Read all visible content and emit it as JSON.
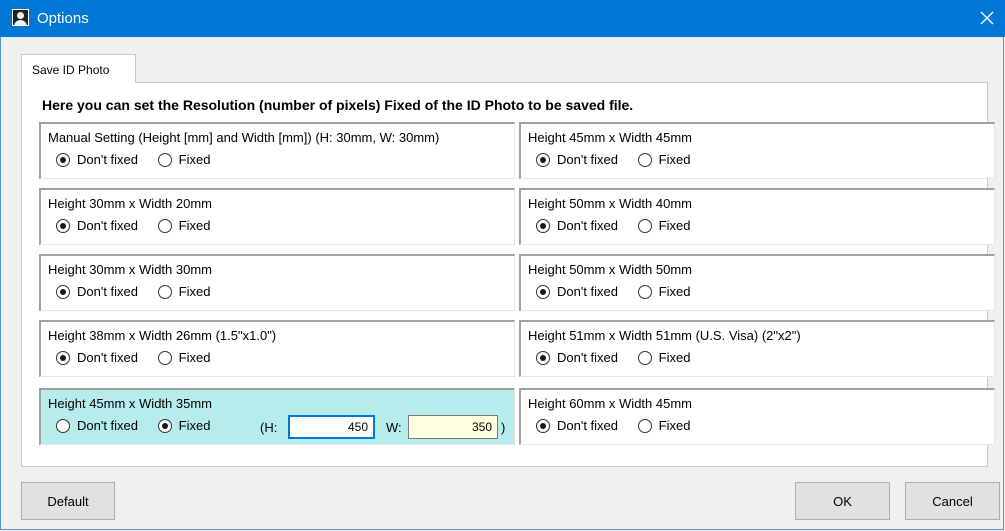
{
  "window": {
    "title": "Options",
    "icon": "id-photo-person-icon"
  },
  "tabs": [
    {
      "label": "Save ID Photo",
      "selected": true
    }
  ],
  "heading": "Here you can set the Resolution (number of pixels) Fixed of the ID Photo to be saved file.",
  "radio_labels": {
    "dont_fixed": "Don't fixed",
    "fixed": "Fixed"
  },
  "groups": [
    {
      "title": "Manual Setting (Height [mm] and Width [mm]) (H: 30mm, W: 30mm)",
      "selected": "dont_fixed"
    },
    {
      "title": "Height 30mm x Width 20mm",
      "selected": "dont_fixed"
    },
    {
      "title": "Height 30mm x Width 30mm",
      "selected": "dont_fixed"
    },
    {
      "title": "Height 38mm x Width 26mm (1.5\"x1.0\")",
      "selected": "dont_fixed"
    },
    {
      "title": "Height 45mm x Width 35mm",
      "selected": "fixed",
      "highlighted": true
    },
    {
      "title": "Height 45mm x Width 45mm",
      "selected": "dont_fixed"
    },
    {
      "title": "Height 50mm x Width 40mm",
      "selected": "dont_fixed"
    },
    {
      "title": "Height 50mm x Width 50mm",
      "selected": "dont_fixed"
    },
    {
      "title": "Height 51mm x Width 51mm (U.S. Visa) (2\"x2\")",
      "selected": "dont_fixed"
    },
    {
      "title": "Height 60mm x Width 45mm",
      "selected": "dont_fixed"
    }
  ],
  "pixel_fields": {
    "h_label": "(H:",
    "h_value": "450",
    "w_label": "W:",
    "w_value": "350",
    "close_paren": ")"
  },
  "buttons": {
    "default": "Default",
    "ok": "OK",
    "cancel": "Cancel"
  },
  "colors": {
    "titlebar": "#0078d7",
    "highlight_group": "#b6ecec",
    "w_field_bg": "#ffffe1",
    "h_field_border": "#0078d7"
  }
}
